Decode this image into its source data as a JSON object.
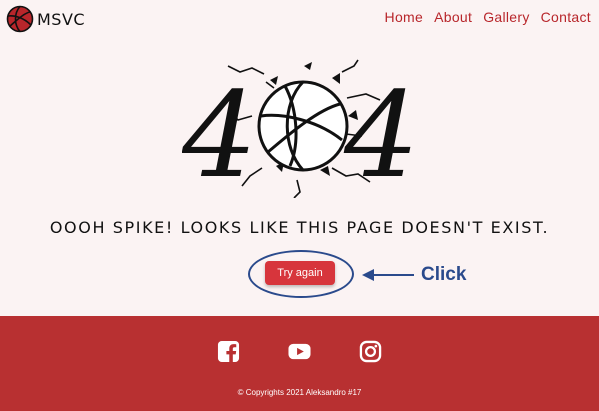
{
  "header": {
    "brand": "MSVC",
    "nav": [
      "Home",
      "About",
      "Gallery",
      "Contact"
    ]
  },
  "hero": {
    "digits": [
      "4",
      "4"
    ]
  },
  "message": "Oooh spike! Looks like this page doesn't exist.",
  "button": {
    "label": "Try again"
  },
  "annotation": {
    "label": "Click"
  },
  "footer": {
    "social": [
      "facebook-icon",
      "youtube-icon",
      "instagram-icon"
    ],
    "copyright": "© Copyrights 2021 Aleksandro #17"
  },
  "colors": {
    "background": "#fbf3f3",
    "accent": "#b8262b",
    "button": "#d7353c",
    "footer": "#b83031",
    "annotation": "#2a4a8c"
  }
}
